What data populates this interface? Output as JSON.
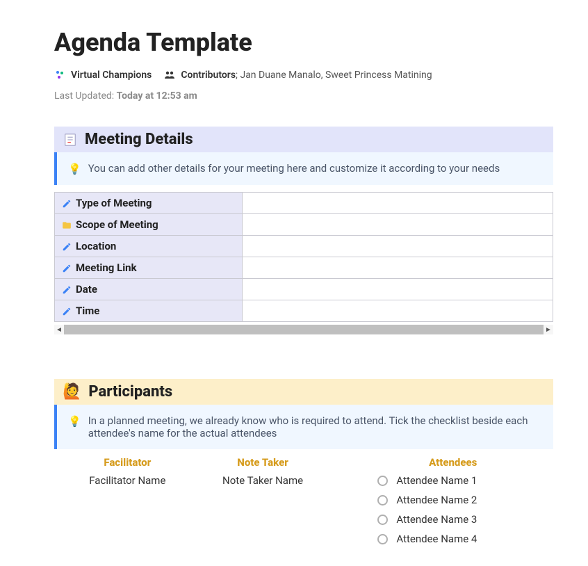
{
  "title": "Agenda Template",
  "workspace": "Virtual Champions",
  "contributors_label": "Contributors",
  "contributors_value": "; Jan Duane Manalo, Sweet Princess Matining",
  "last_updated_label": "Last Updated: ",
  "last_updated_value": "Today at 12:53 am",
  "meeting_details": {
    "header": "Meeting Details",
    "callout": "You can add other details for your meeting here and customize it according to your needs",
    "rows": [
      {
        "label": "Type of Meeting",
        "icon": "pencil"
      },
      {
        "label": "Scope of Meeting",
        "icon": "folder"
      },
      {
        "label": "Location",
        "icon": "pencil"
      },
      {
        "label": "Meeting Link",
        "icon": "pencil"
      },
      {
        "label": "Date",
        "icon": "pencil"
      },
      {
        "label": "Time",
        "icon": "pencil"
      }
    ]
  },
  "participants": {
    "header": "Participants",
    "callout": "In a planned meeting, we already know who is required to attend. Tick the checklist beside each attendee's name for the actual attendees",
    "facilitator_header": "Facilitator",
    "facilitator_value": "Facilitator Name",
    "notetaker_header": "Note Taker",
    "notetaker_value": "Note Taker Name",
    "attendees_header": "Attendees",
    "attendees": [
      "Attendee Name 1",
      "Attendee Name 2",
      "Attendee Name 3",
      "Attendee Name 4"
    ]
  }
}
